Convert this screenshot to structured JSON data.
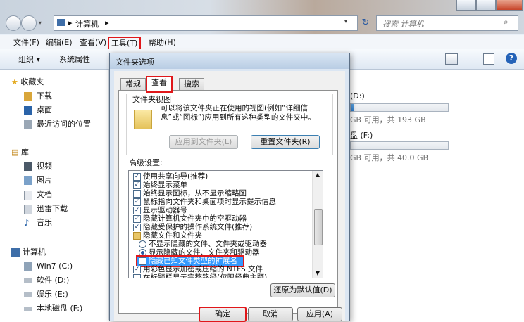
{
  "explorer": {
    "breadcrumb": {
      "sep": "▸",
      "item": "计算机",
      "sep2": "▸"
    },
    "search_placeholder": "搜索 计算机",
    "menu": [
      {
        "label": "文件(F)"
      },
      {
        "label": "编辑(E)"
      },
      {
        "label": "查看(V)"
      },
      {
        "label": "工具(T)"
      },
      {
        "label": "帮助(H)"
      }
    ],
    "toolbar": {
      "organize": "组织 ▾",
      "properties": "系统属性"
    },
    "nav": {
      "favorites": "收藏夹",
      "favorites_items": [
        "下载",
        "桌面",
        "最近访问的位置"
      ],
      "libraries": "库",
      "library_items": [
        "视频",
        "图片",
        "文档",
        "迅雷下载",
        "音乐"
      ],
      "computer": "计算机",
      "drives": [
        "Win7 (C:)",
        "软件 (D:)",
        "娱乐 (E:)",
        "本地磁盘 (F:)"
      ]
    },
    "content": {
      "drive1_label": "(D:)",
      "drive1_free_text": "GB 可用，共 193 GB",
      "drive1_used_fraction": 0.03,
      "drive2_label": "盘 (F:)",
      "drive2_free_text": "GB 可用，共 40.0 GB",
      "drive2_used_fraction": 0.0
    }
  },
  "dialog": {
    "title": "文件夹选项",
    "tabs": [
      "常规",
      "查看",
      "搜索"
    ],
    "folder_views": {
      "heading": "文件夹视图",
      "description": "可以将该文件夹正在使用的视图(例如“详细信息”或“图标”)应用到所有这种类型的文件夹中。",
      "apply_button": "应用到文件夹(L)",
      "reset_button": "重置文件夹(R)"
    },
    "advanced_label": "高级设置:",
    "advanced_items": [
      {
        "type": "check",
        "checked": true,
        "label": "使用共享向导(推荐)"
      },
      {
        "type": "check",
        "checked": true,
        "label": "始终显示菜单"
      },
      {
        "type": "check",
        "checked": false,
        "label": "始终显示图标，从不显示缩略图"
      },
      {
        "type": "check",
        "checked": true,
        "label": "鼠标指向文件夹和桌面项时显示提示信息"
      },
      {
        "type": "check",
        "checked": true,
        "label": "显示驱动器号"
      },
      {
        "type": "check",
        "checked": true,
        "label": "隐藏计算机文件夹中的空驱动器"
      },
      {
        "type": "check",
        "checked": true,
        "label": "隐藏受保护的操作系统文件(推荐)"
      },
      {
        "type": "folder",
        "checked": false,
        "label": "隐藏文件和文件夹"
      },
      {
        "type": "radio",
        "checked": false,
        "label": "不显示隐藏的文件、文件夹或驱动器"
      },
      {
        "type": "radio",
        "checked": true,
        "label": "显示隐藏的文件、文件夹和驱动器"
      },
      {
        "type": "check",
        "checked": false,
        "label": "隐藏已知文件类型的扩展名"
      },
      {
        "type": "check",
        "checked": true,
        "label": "用彩色显示加密或压缩的 NTFS 文件"
      },
      {
        "type": "check",
        "checked": false,
        "label": "在标题栏显示完整路径(仅限经典主题)"
      }
    ],
    "restore_defaults": "还原为默认值(D)",
    "ok": "确定",
    "cancel": "取消",
    "apply": "应用(A)"
  }
}
